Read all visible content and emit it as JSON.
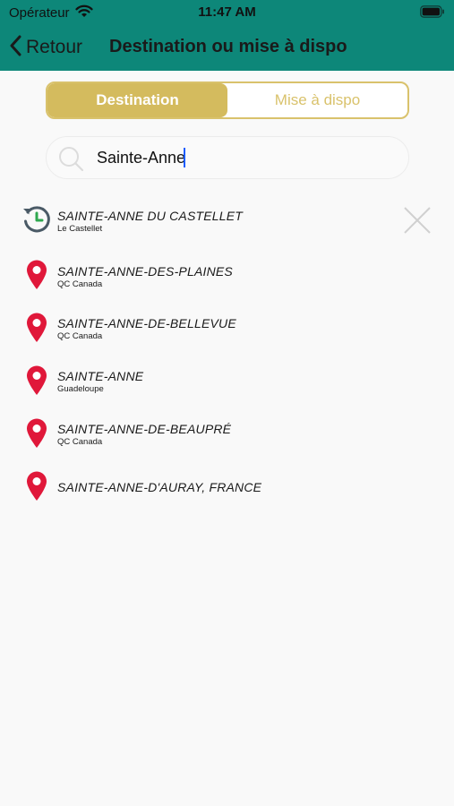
{
  "status_bar": {
    "carrier": "Opérateur",
    "time": "11:47 AM"
  },
  "nav": {
    "back_label": "Retour",
    "title": "Destination ou mise à dispo"
  },
  "segments": {
    "active": "Destination",
    "inactive": "Mise à dispo"
  },
  "search": {
    "value": "Sainte-Anne",
    "placeholder": ""
  },
  "results": [
    {
      "icon": "history-icon",
      "title": "SAINTE-ANNE DU CASTELLET",
      "subtitle": "Le Castellet"
    },
    {
      "icon": "location-pin-icon",
      "title": "SAINTE-ANNE-DES-PLAINES",
      "subtitle": "QC Canada"
    },
    {
      "icon": "location-pin-icon",
      "title": "SAINTE-ANNE-DE-BELLEVUE",
      "subtitle": "QC Canada"
    },
    {
      "icon": "location-pin-icon",
      "title": "SAINTE-ANNE",
      "subtitle": "Guadeloupe"
    },
    {
      "icon": "location-pin-icon",
      "title": "SAINTE-ANNE-DE-BEAUPRÉ",
      "subtitle": "QC Canada"
    },
    {
      "icon": "location-pin-icon",
      "title": "SAINTE-ANNE-D'AURAY, FRANCE",
      "subtitle": ""
    }
  ],
  "colors": {
    "header": "#0d8779",
    "accent_gold": "#d4bb5e",
    "pin_red": "#e0183a"
  }
}
